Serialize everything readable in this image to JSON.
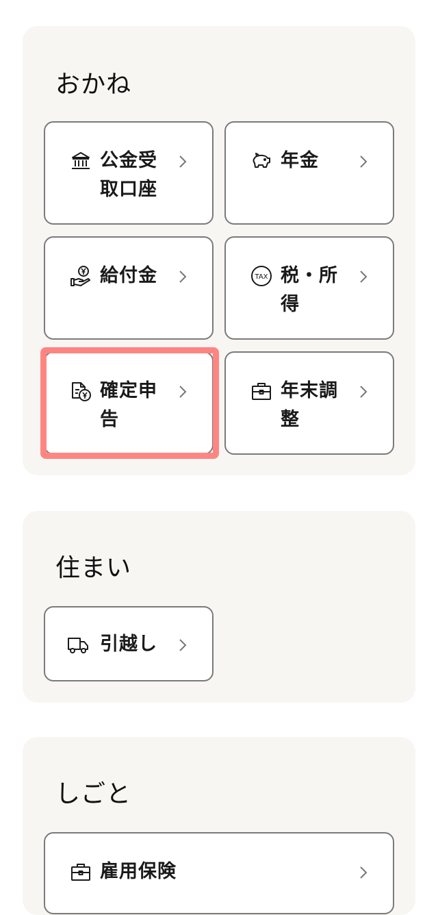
{
  "sections": [
    {
      "title": "おかね",
      "cards": [
        {
          "label": "公金受取口座",
          "icon": "bank-icon"
        },
        {
          "label": "年金",
          "icon": "piggy-bank-icon"
        },
        {
          "label": "給付金",
          "icon": "yen-hand-icon"
        },
        {
          "label": "税・所得",
          "icon": "tax-icon"
        },
        {
          "label": "確定申告",
          "icon": "tax-return-document-icon"
        },
        {
          "label": "年末調整",
          "icon": "briefcase-icon"
        }
      ]
    },
    {
      "title": "住まい",
      "cards": [
        {
          "label": "引越し",
          "icon": "moving-truck-icon"
        }
      ]
    },
    {
      "title": "しごと",
      "cards": [
        {
          "label": "雇用保険",
          "icon": "briefcase-icon"
        }
      ]
    }
  ],
  "highlight_target": "確定申告",
  "colors": {
    "section_bg": "#f8f6f2",
    "card_border": "#7a7a7a",
    "highlight": "#ff8582"
  }
}
